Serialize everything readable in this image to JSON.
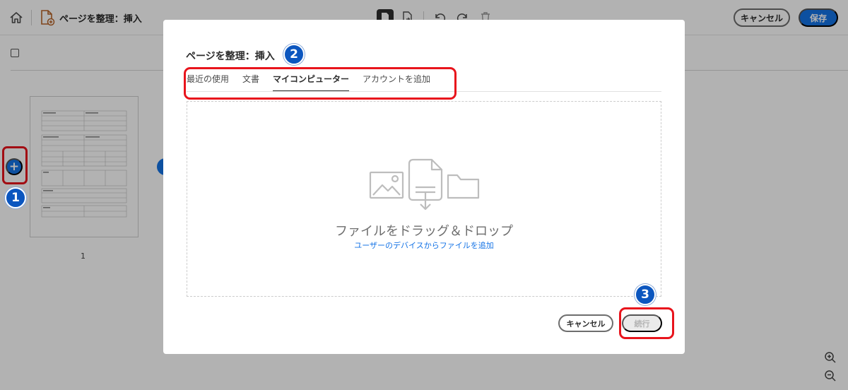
{
  "topbar": {
    "title": "ページを整理：挿入",
    "cancel_label": "キャンセル",
    "save_label": "保存",
    "icons": [
      "home-icon",
      "organize-pages-icon",
      "page-icon",
      "extract-page-icon",
      "undo-icon",
      "redo-icon",
      "trash-icon"
    ]
  },
  "thumbnail": {
    "page_number": "1"
  },
  "badges": {
    "step1": "1",
    "step2": "2",
    "step3": "3"
  },
  "modal": {
    "title": "ページを整理：挿入",
    "tabs": [
      {
        "label": "最近の使用",
        "active": false
      },
      {
        "label": "文書",
        "active": false
      },
      {
        "label": "マイコンピューター",
        "active": true
      },
      {
        "label": "アカウントを追加",
        "active": false
      }
    ],
    "dropzone": {
      "title": "ファイルをドラッグ＆ドロップ",
      "link": "ユーザーのデバイスからファイルを追加"
    },
    "cancel_label": "キャンセル",
    "continue_label": "続行"
  },
  "colors": {
    "accent": "#1473e6",
    "highlight": "#e8141c",
    "badge": "#0b56bf"
  }
}
